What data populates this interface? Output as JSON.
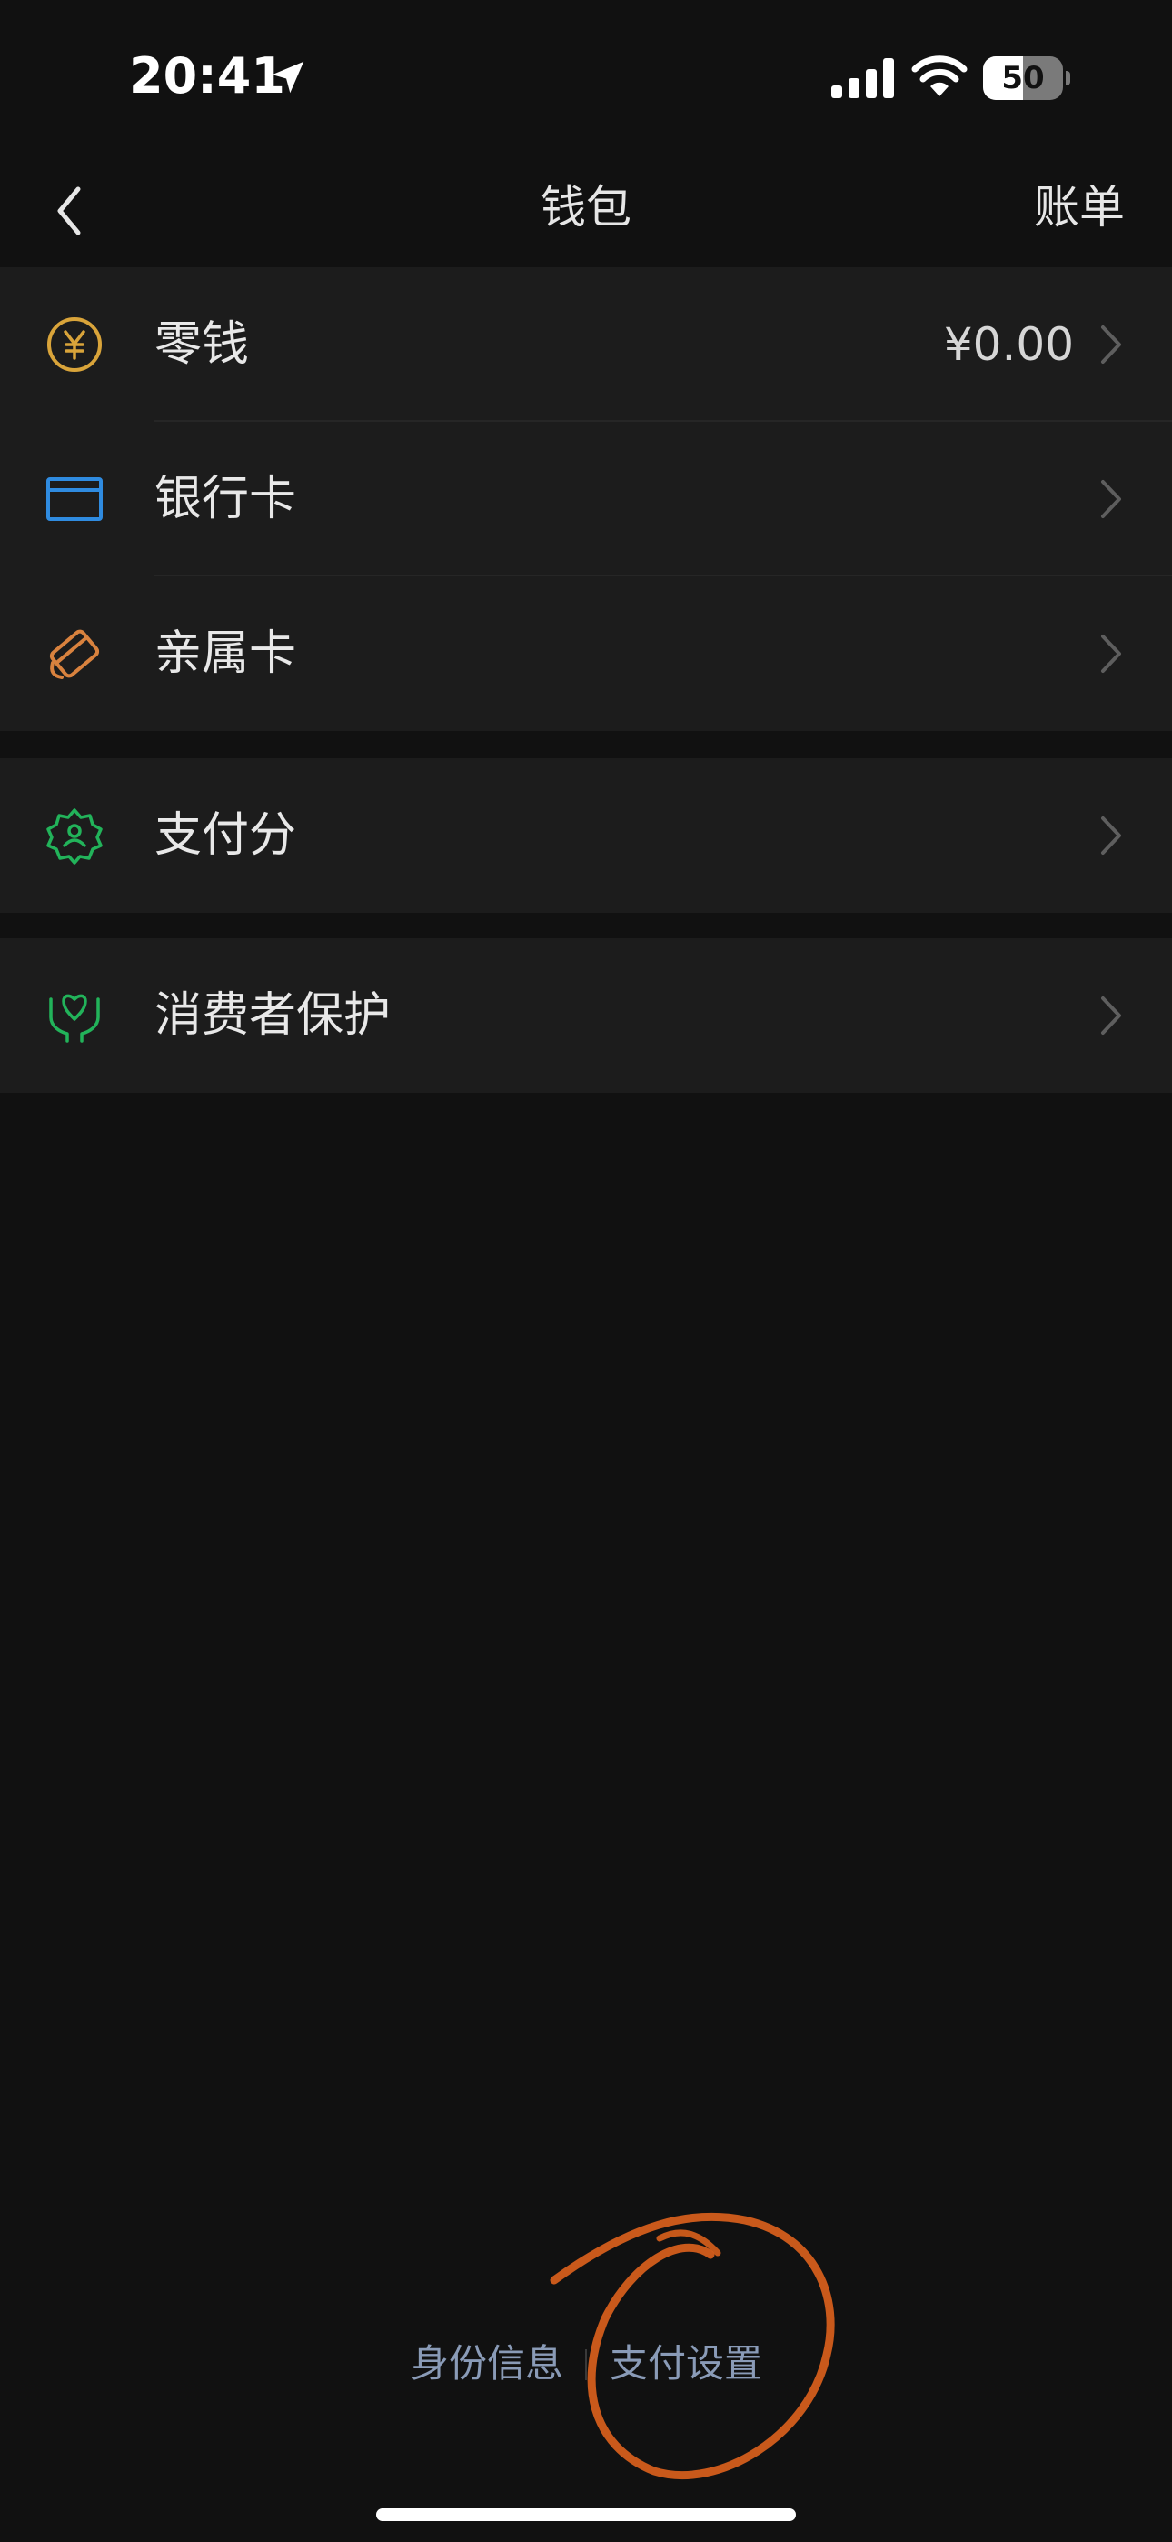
{
  "status_bar": {
    "time": "20:41",
    "battery_level": 50,
    "battery_text": "50",
    "icons": [
      "location-arrow-icon",
      "cellular-signal-icon",
      "wifi-icon",
      "battery-icon"
    ]
  },
  "nav": {
    "back_icon": "chevron-left-icon",
    "title": "钱包",
    "right_action": "账单"
  },
  "groups": [
    {
      "items": [
        {
          "label": "零钱",
          "value": "¥0.00",
          "icon": "yuan-coin-icon",
          "icon_color": "#d9a43a"
        },
        {
          "label": "银行卡",
          "value": "",
          "icon": "bank-card-icon",
          "icon_color": "#2f8be0"
        },
        {
          "label": "亲属卡",
          "value": "",
          "icon": "family-card-icon",
          "icon_color": "#d9823e"
        }
      ]
    },
    {
      "items": [
        {
          "label": "支付分",
          "value": "",
          "icon": "pay-score-badge-icon",
          "icon_color": "#22b35a"
        }
      ]
    },
    {
      "items": [
        {
          "label": "消费者保护",
          "value": "",
          "icon": "hands-protect-icon",
          "icon_color": "#22b35a"
        }
      ]
    }
  ],
  "footer": {
    "links": [
      "身份信息",
      "支付设置"
    ],
    "annotation_color": "#d9601c"
  },
  "colors": {
    "background": "#111111",
    "cell_background": "#1c1c1c",
    "link": "#8a9bb7",
    "chevron": "#5e5e5e"
  }
}
